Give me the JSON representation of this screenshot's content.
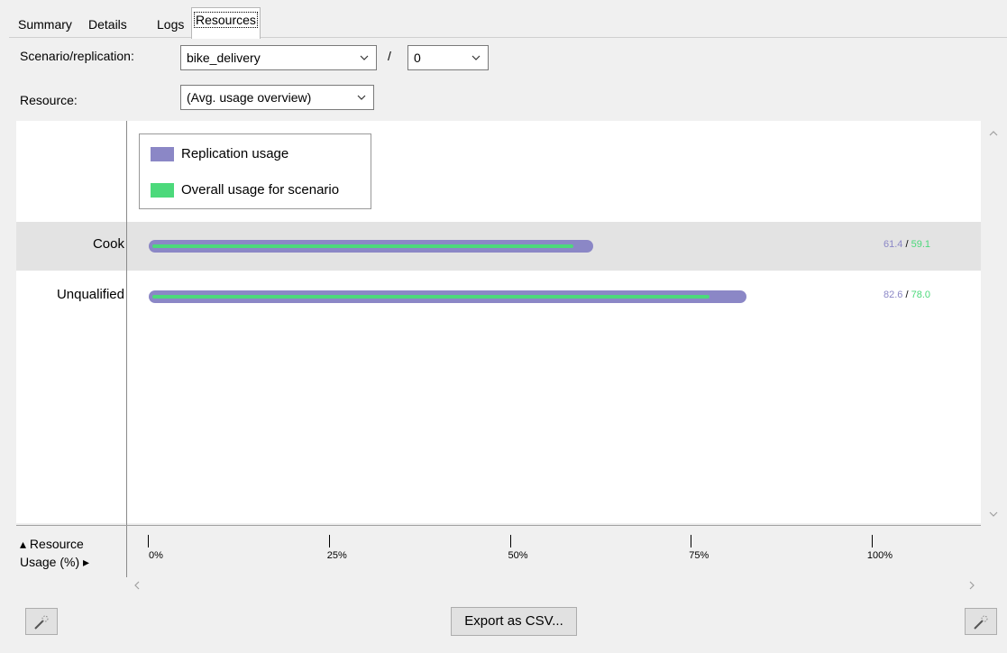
{
  "tabs": [
    "Summary",
    "Details",
    "Logs",
    "Resources"
  ],
  "controls": {
    "scenario_label": "Scenario/replication:",
    "scenario_value": "bike_delivery",
    "separator": "/",
    "replication_value": "0",
    "resource_label": "Resource:",
    "resource_value": "(Avg. usage overview)"
  },
  "legend": {
    "replication": "Replication usage",
    "overall": "Overall usage for scenario"
  },
  "colors": {
    "replication": "#8b87c6",
    "overall": "#4cd97b"
  },
  "chart_data": {
    "type": "bar",
    "categories": [
      "Cook",
      "Unqualified"
    ],
    "series": [
      {
        "name": "Replication usage",
        "values": [
          61.4,
          82.6
        ]
      },
      {
        "name": "Overall usage for scenario",
        "values": [
          59.1,
          78.0
        ]
      }
    ],
    "value_labels": [
      {
        "replication": "61.4",
        "overall": "59.1"
      },
      {
        "replication": "82.6",
        "overall": "78.0"
      }
    ],
    "xlim": [
      0,
      100
    ],
    "xticks": [
      "0%",
      "25%",
      "50%",
      "75%",
      "100%"
    ],
    "xlabel_line1": "▴ Resource",
    "xlabel_line2": "Usage (%) ▸"
  },
  "footer": {
    "export_label": "Export as CSV..."
  }
}
